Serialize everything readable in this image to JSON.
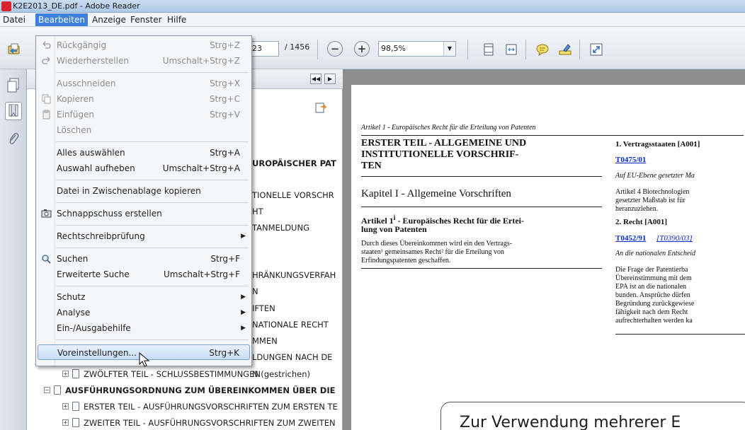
{
  "window": {
    "title": "K2E2013_DE.pdf - Adobe Reader"
  },
  "menubar": {
    "items": [
      {
        "label": "Datei"
      },
      {
        "label": "Bearbeiten"
      },
      {
        "label": "Anzeige"
      },
      {
        "label": "Fenster"
      },
      {
        "label": "Hilfe"
      }
    ]
  },
  "toolbar": {
    "page_current": "23",
    "page_total": "/ 1456",
    "zoom": "98,5%"
  },
  "edit_menu": {
    "items": [
      {
        "label": "Rückgängig",
        "shortcut": "Strg+Z",
        "disabled": true,
        "icon": "undo-icon"
      },
      {
        "label": "Wiederherstellen",
        "shortcut": "Umschalt+Strg+Z",
        "disabled": true,
        "icon": "redo-icon"
      },
      {
        "label": "Ausschneiden",
        "shortcut": "Strg+X",
        "disabled": true
      },
      {
        "label": "Kopieren",
        "shortcut": "Strg+C",
        "disabled": true,
        "icon": "copy-icon"
      },
      {
        "label": "Einfügen",
        "shortcut": "Strg+V",
        "disabled": true,
        "icon": "paste-icon"
      },
      {
        "label": "Löschen",
        "shortcut": "",
        "disabled": true
      },
      {
        "label": "Alles auswählen",
        "shortcut": "Strg+A"
      },
      {
        "label": "Auswahl aufheben",
        "shortcut": "Umschalt+Strg+A"
      },
      {
        "label": "Datei in Zwischenablage kopieren",
        "shortcut": ""
      },
      {
        "label": "Schnappschuss erstellen",
        "shortcut": "",
        "icon": "camera-icon"
      },
      {
        "label": "Rechtschreibprüfung",
        "shortcut": "",
        "submenu": true
      },
      {
        "label": "Suchen",
        "shortcut": "Strg+F",
        "icon": "search-icon"
      },
      {
        "label": "Erweiterte Suche",
        "shortcut": "Umschalt+Strg+F"
      },
      {
        "label": "Schutz",
        "shortcut": "",
        "submenu": true
      },
      {
        "label": "Analyse",
        "shortcut": "",
        "submenu": true
      },
      {
        "label": "Ein-/Ausgabehilfe",
        "shortcut": "",
        "submenu": true
      },
      {
        "label": "Voreinstellungen...",
        "shortcut": "Strg+K",
        "highlighted": true
      }
    ]
  },
  "bookmarks": {
    "visible_fragments": [
      "UROPÄISCHER PAT",
      "TIONELLE VORSCHR",
      "HT",
      "TANMELDUNG",
      "HRÄNKUNGSVERFAH",
      "N",
      "IFTEN",
      "NATIONALE RECHT",
      "MMEN",
      "LDUNGEN NACH DE",
      "N (gestrichen)"
    ],
    "items": [
      {
        "label": "ZWÖLFTER TEIL - SCHLUSSBESTIMMUNGEN",
        "bold": false
      },
      {
        "label": "AUSFÜHRUNGSORDNUNG ZUM ÜBEREINKOMMEN ÜBER DIE",
        "bold": true
      },
      {
        "label": "ERSTER TEIL - AUSFÜHRUNGSVORSCHRIFTEN ZUM ERSTEN TE",
        "bold": false
      },
      {
        "label": "ZWEITER TEIL - AUSFÜHRUNGSVORSCHRIFTEN ZUM ZWEITEN",
        "bold": false
      }
    ]
  },
  "document": {
    "running_header": "Artikel 1 - Europäisches Recht für die Erteilung von Patenten",
    "left": {
      "part_heading_1": "ERSTER TEIL - ALLGEMEINE UND",
      "part_heading_2": "INSTITUTIONELLE VORSCHRIF-",
      "part_heading_3": "TEN",
      "chapter": "Kapitel I - Allgemeine Vorschriften",
      "article_title_1": "Artikel 1",
      "article_sup": "i",
      "article_title_1b": " - Europäisches Recht für die Ertei-",
      "article_title_2": "lung von Patenten",
      "body_1": "Durch dieses Übereinkommen wird ein den Vertrags-",
      "body_2": "staaten¹ gemeinsames Recht² für die Erteilung von",
      "body_3": "Erfindungspatenten geschaffen."
    },
    "right": {
      "h1": "1. Vertragsstaaten [A001]",
      "link1": "T0475/01",
      "italic1": "Auf EU-Ebene gesetzter Ma",
      "p1_1": "Artikel 4 Biotechnologien",
      "p1_2": "gesetzter Maßstab ist für",
      "p1_3": "heranzuziehen.",
      "h2": "2. Recht [A001]",
      "link2": "T0452/91",
      "link2b": "[T0390/03]",
      "italic2": "An die nationalen Entscheid",
      "p2_1": "Die Frage der Patentierba",
      "p2_2": "Übereinstimmung mit dem",
      "p2_3": "EPA ist an die nationalen",
      "p2_4": "bunden. Ansprüche dürfen",
      "p2_5": "Begründung zurückgewiese",
      "p2_6": "fähigkeit nach dem Recht",
      "p2_7": "aufrechterhalten werden ka"
    },
    "overlay_note": "Zur Verwendung mehrerer E"
  }
}
